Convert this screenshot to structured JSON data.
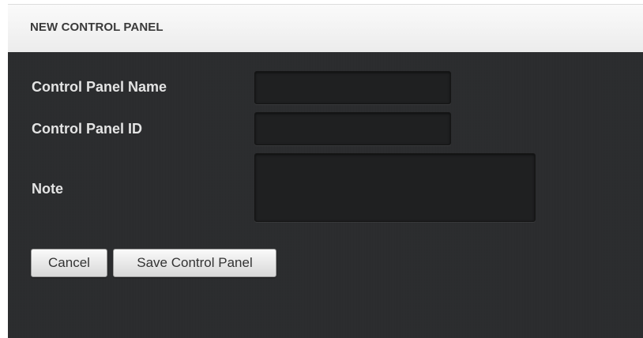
{
  "dialog": {
    "title": "NEW CONTROL PANEL"
  },
  "form": {
    "name": {
      "label": "Control Panel Name",
      "value": ""
    },
    "id": {
      "label": "Control Panel ID",
      "value": ""
    },
    "note": {
      "label": "Note",
      "value": ""
    }
  },
  "buttons": {
    "cancel_label": "Cancel",
    "save_label": "Save Control Panel"
  }
}
